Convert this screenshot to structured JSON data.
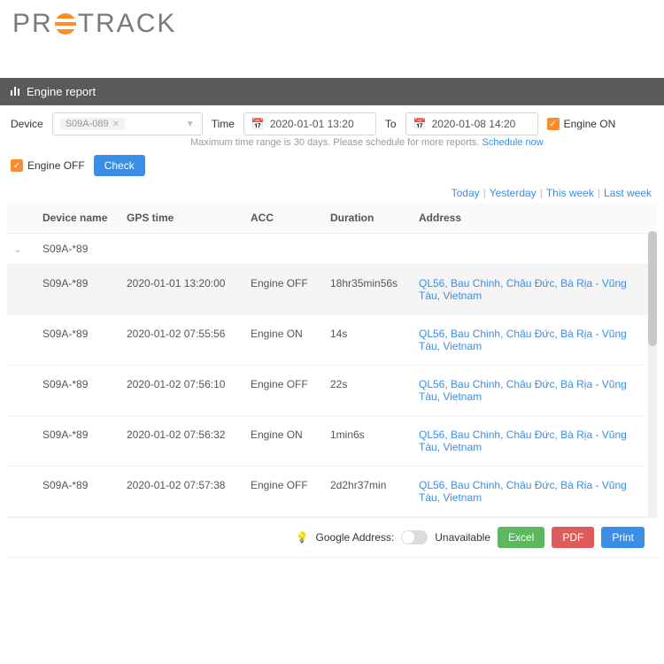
{
  "logo": {
    "pre": "PR",
    "post": "TRACK"
  },
  "title": "Engine report",
  "filters": {
    "deviceLabel": "Device",
    "deviceTag": "S09A-089",
    "timeLabel": "Time",
    "from": "2020-01-01 13:20",
    "toLabel": "To",
    "to": "2020-01-08 14:20",
    "hint": "Maximum time range is 30 days. Please schedule for more reports.",
    "schedule": "Schedule now",
    "engineOn": "Engine ON",
    "engineOff": "Engine OFF",
    "check": "Check"
  },
  "quick": {
    "today": "Today",
    "yesterday": "Yesterday",
    "thisWeek": "This week",
    "lastWeek": "Last week",
    "sep": "|"
  },
  "cols": {
    "device": "Device name",
    "gps": "GPS time",
    "acc": "ACC",
    "dur": "Duration",
    "addr": "Address"
  },
  "group": "S09A-*89",
  "rows": [
    {
      "dev": "S09A-*89",
      "time": "2020-01-01 13:20:00",
      "acc": "Engine OFF",
      "dur": "18hr35min56s",
      "addr": "QL56, Bau Chinh, Châu Đức, Bà Rịa - Vũng Tàu, Vietnam"
    },
    {
      "dev": "S09A-*89",
      "time": "2020-01-02 07:55:56",
      "acc": "Engine ON",
      "dur": "14s",
      "addr": "QL56, Bau Chinh, Châu Đức, Bà Rịa - Vũng Tàu, Vietnam"
    },
    {
      "dev": "S09A-*89",
      "time": "2020-01-02 07:56:10",
      "acc": "Engine OFF",
      "dur": "22s",
      "addr": "QL56, Bau Chinh, Châu Đức, Bà Rịa - Vũng Tàu, Vietnam"
    },
    {
      "dev": "S09A-*89",
      "time": "2020-01-02 07:56:32",
      "acc": "Engine ON",
      "dur": "1min6s",
      "addr": "QL56, Bau Chinh, Châu Đức, Bà Rịa - Vũng Tàu, Vietnam"
    },
    {
      "dev": "S09A-*89",
      "time": "2020-01-02 07:57:38",
      "acc": "Engine OFF",
      "dur": "2d2hr37min",
      "addr": "QL56, Bau Chinh, Châu Đức, Bà Rịa - Vũng Tàu, Vietnam"
    }
  ],
  "footer": {
    "google": "Google Address:",
    "unavail": "Unavailable",
    "excel": "Excel",
    "pdf": "PDF",
    "print": "Print"
  }
}
